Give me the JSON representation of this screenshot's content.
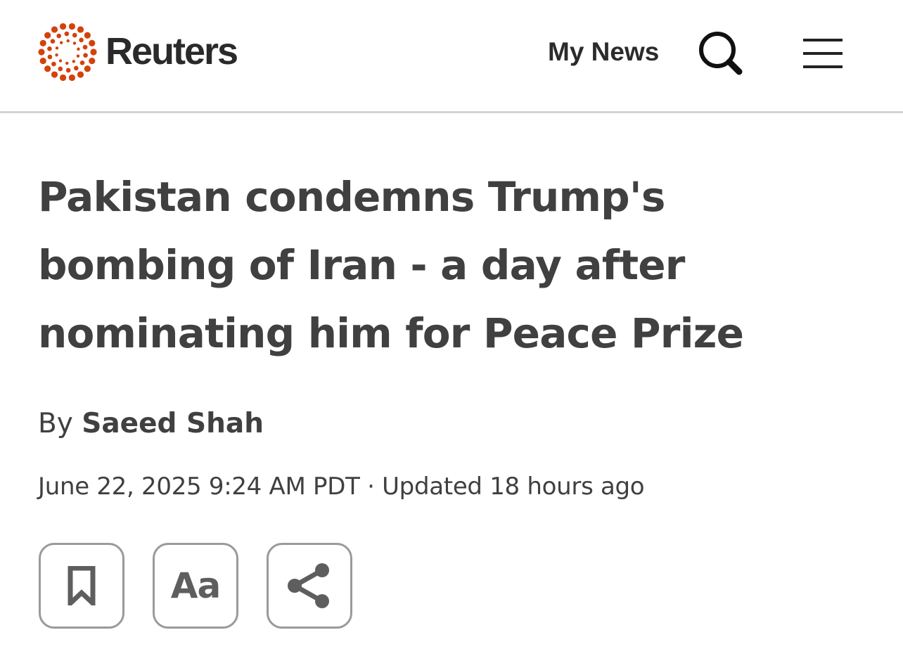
{
  "header": {
    "brand": "Reuters",
    "my_news_label": "My News",
    "icons": {
      "logo": "reuters-dot-ring-logo",
      "search": "search-icon",
      "menu": "hamburger-menu-icon"
    },
    "colors": {
      "logo_orange": "#d4410a",
      "text_dark": "#2b2b2b",
      "divider": "#d4d4d4"
    }
  },
  "article": {
    "headline": "Pakistan condemns Trump's bombing of Iran - a day after nominating him for Peace Prize",
    "byline_prefix": "By",
    "author": "Saeed Shah",
    "dateline": "June 22, 2025 9:24 AM PDT · Updated 18 hours ago"
  },
  "tools": {
    "bookmark_icon": "bookmark-icon",
    "font_size_label": "Aa",
    "share_icon": "share-icon"
  }
}
